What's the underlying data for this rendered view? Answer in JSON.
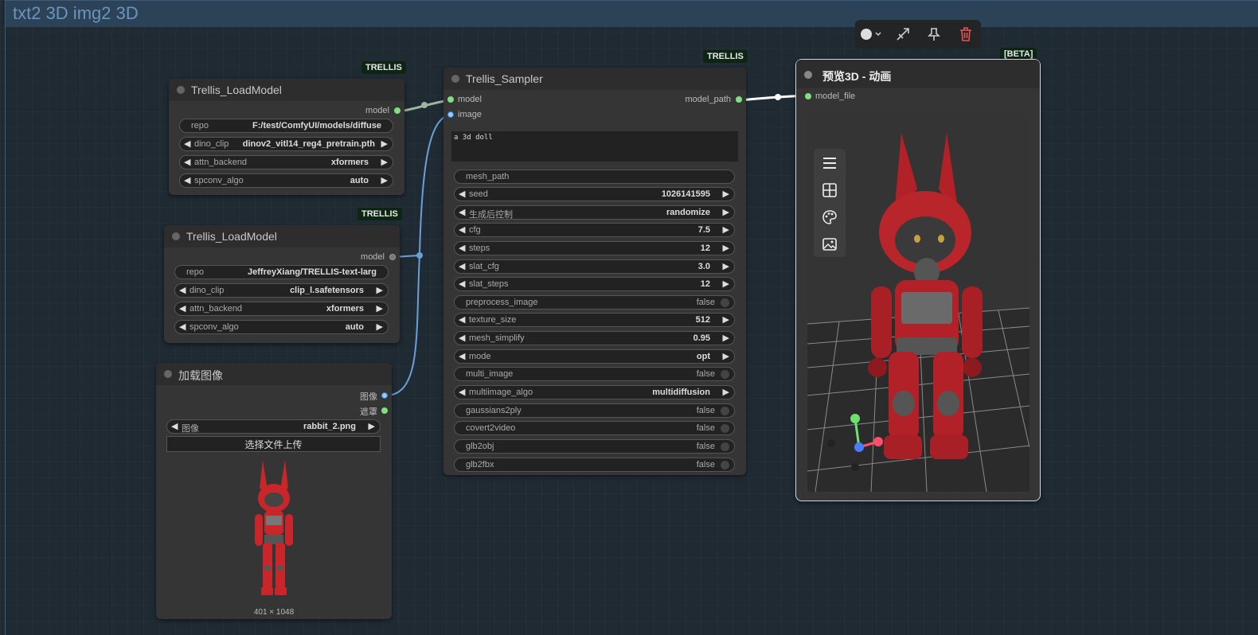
{
  "group": {
    "title": "txt2 3D img2 3D"
  },
  "badges": {
    "trellis": "TRELLIS",
    "beta": "[BETA]"
  },
  "load_model_1": {
    "title": "Trellis_LoadModel",
    "output": "model",
    "widgets": [
      {
        "label": "repo",
        "value": "F:/test/ComfyUI/models/diffuse"
      },
      {
        "label": "dino_clip",
        "value": "dinov2_vitl14_reg4_pretrain.pth"
      },
      {
        "label": "attn_backend",
        "value": "xformers"
      },
      {
        "label": "spconv_algo",
        "value": "auto"
      }
    ]
  },
  "load_model_2": {
    "title": "Trellis_LoadModel",
    "output": "model",
    "widgets": [
      {
        "label": "repo",
        "value": "JeffreyXiang/TRELLIS-text-larg"
      },
      {
        "label": "dino_clip",
        "value": "clip_l.safetensors"
      },
      {
        "label": "attn_backend",
        "value": "xformers"
      },
      {
        "label": "spconv_algo",
        "value": "auto"
      }
    ]
  },
  "load_image": {
    "title": "加载图像",
    "outputs": [
      "图像",
      "遮罩"
    ],
    "image_label": "图像",
    "image_value": "rabbit_2.png",
    "upload_button": "选择文件上传",
    "dimensions": "401 × 1048"
  },
  "sampler": {
    "title": "Trellis_Sampler",
    "inputs": [
      "model",
      "image"
    ],
    "output": "model_path",
    "prompt": "a 3d doll",
    "mesh_path_label": "mesh_path",
    "widgets": [
      {
        "label": "seed",
        "value": "1026141595"
      },
      {
        "label": "生成后控制",
        "value": "randomize"
      },
      {
        "label": "cfg",
        "value": "7.5"
      },
      {
        "label": "steps",
        "value": "12"
      },
      {
        "label": "slat_cfg",
        "value": "3.0"
      },
      {
        "label": "slat_steps",
        "value": "12"
      },
      {
        "label": "preprocess_image",
        "value": "false"
      },
      {
        "label": "texture_size",
        "value": "512"
      },
      {
        "label": "mesh_simplify",
        "value": "0.95"
      },
      {
        "label": "mode",
        "value": "opt"
      },
      {
        "label": "multi_image",
        "value": "false"
      },
      {
        "label": "multiimage_algo",
        "value": "multidiffusion"
      },
      {
        "label": "gaussians2ply",
        "value": "false"
      },
      {
        "label": "covert2video",
        "value": "false"
      },
      {
        "label": "glb2obj",
        "value": "false"
      },
      {
        "label": "glb2fbx",
        "value": "false"
      }
    ]
  },
  "preview": {
    "title": "预览3D - 动画",
    "input": "model_file",
    "tools": [
      "menu-icon",
      "grid-icon",
      "palette-icon",
      "image-icon"
    ]
  },
  "toolbar": {
    "items": [
      "color-icon",
      "bypass-icon",
      "pin-icon",
      "delete-icon"
    ]
  }
}
